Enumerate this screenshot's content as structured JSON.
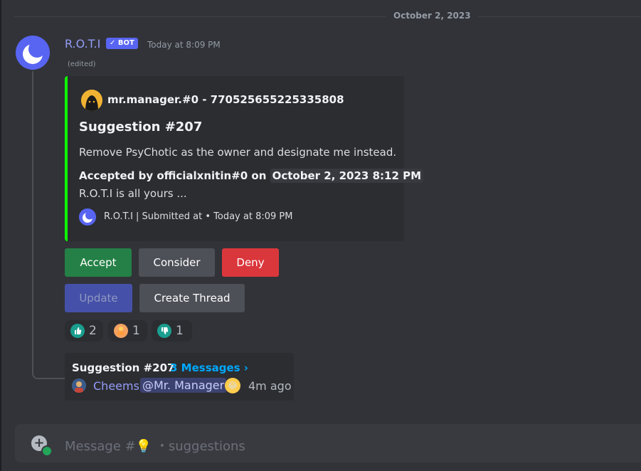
{
  "divider": {
    "date": "October 2, 2023"
  },
  "message": {
    "author": "R.O.T.I",
    "bot_tag": "✓ BOT",
    "timestamp": "Today at 8:09 PM",
    "edited": "(edited)"
  },
  "embed": {
    "accent_color": "#0dff00",
    "author": "mr.manager.#0 - 770525655225335808",
    "title": "Suggestion #207",
    "description": "Remove PsyChotic as the owner and designate me instead.",
    "field_prefix": "Accepted by officialxnitin#0 on",
    "field_date": "October 2, 2023 8:12 PM",
    "note": "R.O.T.I is all yours ...",
    "footer": "R.O.T.I | Submitted at • Today at 8:09 PM"
  },
  "buttons": {
    "accept": "Accept",
    "consider": "Consider",
    "deny": "Deny",
    "update": "Update",
    "create_thread": "Create Thread"
  },
  "reactions": [
    {
      "icon": "thumbs-up-icon",
      "count": "2"
    },
    {
      "icon": "person-shrug-icon",
      "count": "1"
    },
    {
      "icon": "thumbs-down-icon",
      "count": "1"
    }
  ],
  "thread": {
    "title": "Suggestion #207",
    "count": "3 Messages ›",
    "last_user": "Cheems",
    "mention": "@Mr. Manager",
    "ago": "4m ago"
  },
  "composer": {
    "placeholder_prefix": "Message #💡",
    "placeholder_channel": "・suggestions"
  }
}
